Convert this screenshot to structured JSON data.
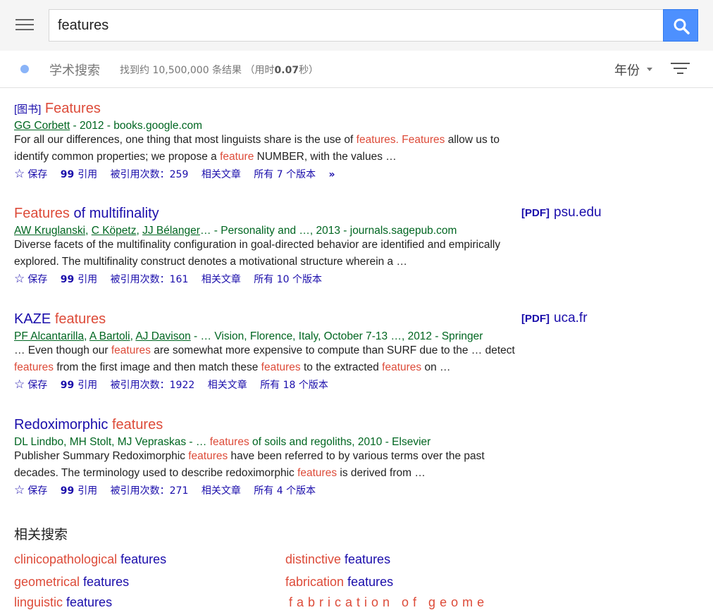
{
  "search": {
    "value": "features"
  },
  "subbar": {
    "title": "学术搜索",
    "count_prefix": "找到约 10,500,000 条结果",
    "time_open": "（用时",
    "time_value": "0.07",
    "time_close": "秒）",
    "year_label": "年份"
  },
  "results": [
    {
      "badge": "[图书]",
      "title_hl": "Features",
      "meta": {
        "authors": [
          "GG Corbett"
        ],
        "rest": " - 2012 - books.google.com"
      },
      "snippet_parts": [
        {
          "t": "For all our differences, one thing that most linguists share is the use of ",
          "hl": false
        },
        {
          "t": "features. Features",
          "hl": true
        },
        {
          "t": " allow us to identify common properties; we propose a ",
          "hl": false
        },
        {
          "t": "feature",
          "hl": true
        },
        {
          "t": " NUMBER, with the values …",
          "hl": false
        }
      ],
      "actions": {
        "save": "保存",
        "cite": "引用",
        "cited_by": "被引用次数：259",
        "related": "相关文章",
        "versions": "所有 7 个版本",
        "more": "»"
      }
    },
    {
      "title_hl": "Features",
      "title_rest": " of multifinality",
      "pdf": {
        "tag": "[PDF]",
        "domain": "psu.edu"
      },
      "meta": {
        "authors": [
          "AW Kruglanski",
          "C Köpetz",
          "JJ Bélanger"
        ],
        "rest": "… - Personality and …, 2013 - journals.sagepub.com"
      },
      "snippet_parts": [
        {
          "t": "Diverse facets of the multifinality configuration in goal-directed behavior are identified and empirically explored. The multifinality construct denotes a motivational structure wherein a …",
          "hl": false
        }
      ],
      "actions": {
        "save": "保存",
        "cite": "引用",
        "cited_by": "被引用次数：161",
        "related": "相关文章",
        "versions": "所有 10 个版本"
      }
    },
    {
      "title_base": "KAZE",
      "title_hl": "features",
      "pdf": {
        "tag": "[PDF]",
        "domain": "uca.fr"
      },
      "meta": {
        "authors": [
          "PF Alcantarilla",
          "A Bartoli",
          "AJ Davison"
        ],
        "rest": " - … Vision, Florence, Italy, October 7-13 …, 2012 - Springer"
      },
      "snippet_parts": [
        {
          "t": "… Even though our ",
          "hl": false
        },
        {
          "t": "features",
          "hl": true
        },
        {
          "t": " are somewhat more expensive to compute than SURF due to the … detect ",
          "hl": false
        },
        {
          "t": "features",
          "hl": true
        },
        {
          "t": " from the first image and then match these ",
          "hl": false
        },
        {
          "t": "features",
          "hl": true
        },
        {
          "t": " to the extracted ",
          "hl": false
        },
        {
          "t": "features",
          "hl": true
        },
        {
          "t": " on …",
          "hl": false
        }
      ],
      "actions": {
        "save": "保存",
        "cite": "引用",
        "cited_by": "被引用次数：1922",
        "related": "相关文章",
        "versions": "所有 18 个版本"
      }
    },
    {
      "title_base": "Redoximorphic",
      "title_hl": "features",
      "meta": {
        "authors_plain": "DL Lindbo, MH Stolt, MJ Vepraskas",
        "rest_pre": " - … ",
        "rest_hl": "features",
        "rest_post": " of soils and regoliths, 2010 - Elsevier"
      },
      "snippet_parts": [
        {
          "t": "Publisher Summary Redoximorphic ",
          "hl": false
        },
        {
          "t": "features",
          "hl": true
        },
        {
          "t": " have been referred to by various terms over the past decades. The terminology used to describe redoximorphic ",
          "hl": false
        },
        {
          "t": "features",
          "hl": true
        },
        {
          "t": " is derived from …",
          "hl": false
        }
      ],
      "actions": {
        "save": "保存",
        "cite": "引用",
        "cited_by": "被引用次数：271",
        "related": "相关文章",
        "versions": "所有 4 个版本"
      }
    }
  ],
  "related_searches": {
    "title": "相关搜索",
    "items": [
      {
        "hl": "clinicopathological",
        "base": " features"
      },
      {
        "hl": "distinctive",
        "base": " features"
      },
      {
        "hl": "geometrical",
        "base": " features"
      },
      {
        "hl": "fabrication",
        "base": " features"
      },
      {
        "hl": "linguistic",
        "base": " features"
      },
      {
        "hl": "fabrication of geome",
        "base": ""
      }
    ]
  },
  "colors": {
    "link": "#1a0dab",
    "highlight": "#dd4b39",
    "meta_green": "#006621",
    "search_button": "#4d90fe"
  },
  "icons": [
    "menu-icon",
    "search-icon",
    "scholar-logo-icon",
    "caret-down-icon",
    "filter-icon",
    "star-icon",
    "quote-icon",
    "more-chevron-icon"
  ]
}
